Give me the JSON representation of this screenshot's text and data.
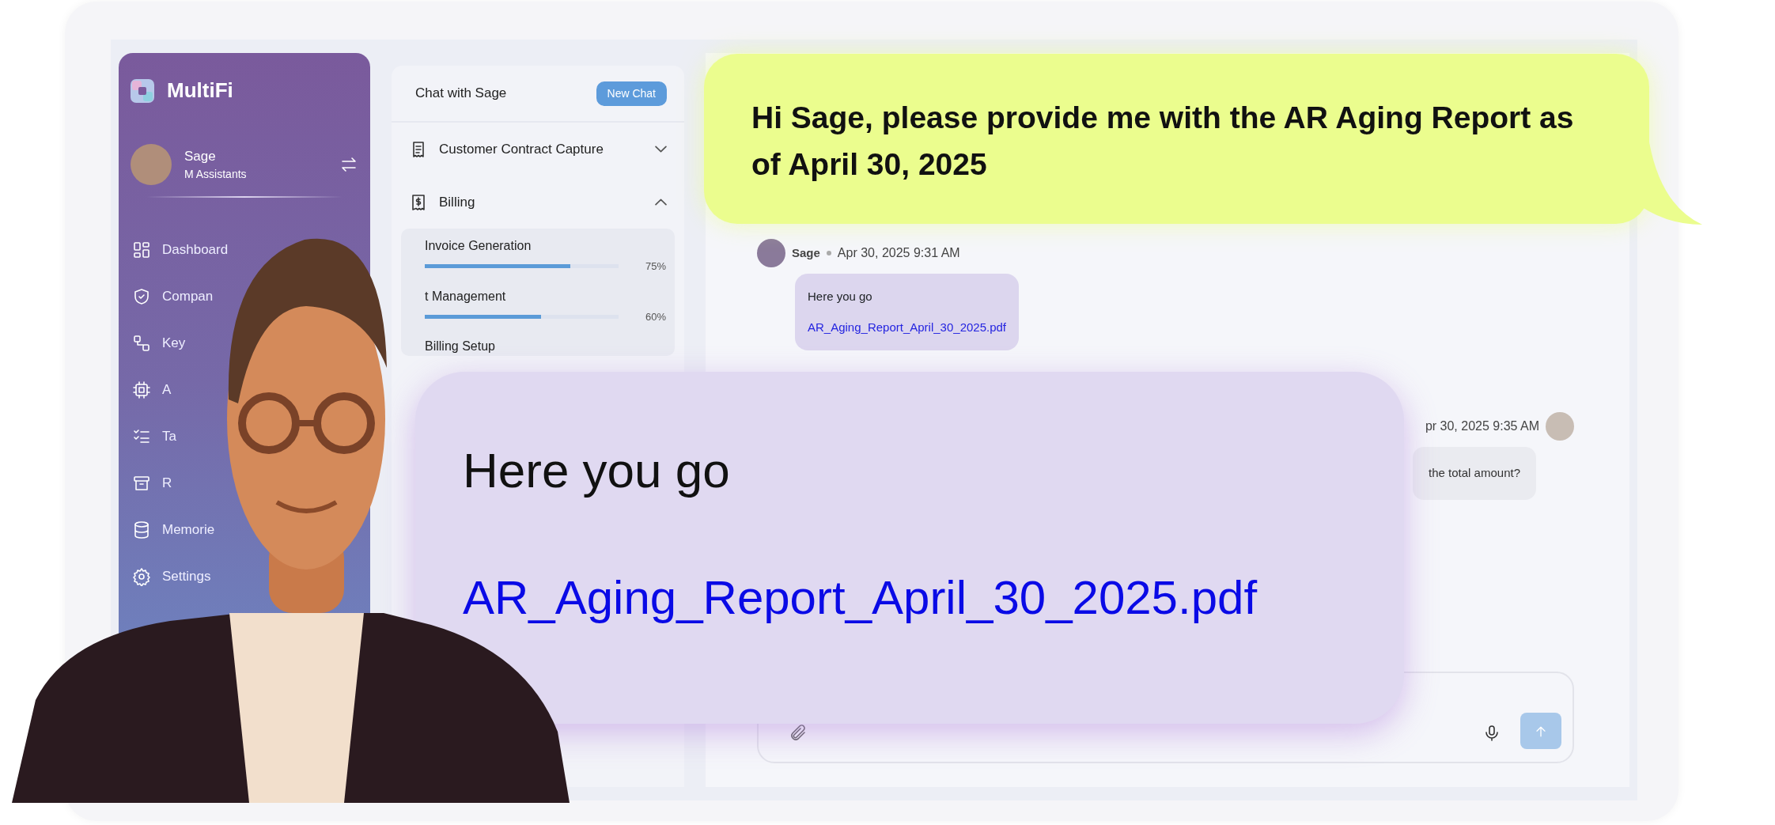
{
  "brand": {
    "name": "MultiFi"
  },
  "profile": {
    "name": "Sage",
    "role": "M Assistants"
  },
  "sidebar": {
    "items": [
      {
        "label": "Dashboard"
      },
      {
        "label": "Compan"
      },
      {
        "label": "Key"
      },
      {
        "label": "A"
      },
      {
        "label": "Ta"
      },
      {
        "label": "R"
      },
      {
        "label": "Memorie"
      },
      {
        "label": "Settings"
      }
    ]
  },
  "chat_panel": {
    "title": "Chat with Sage",
    "new_chat_button": "New Chat",
    "sections": [
      {
        "title": "Customer Contract Capture",
        "expanded": false
      },
      {
        "title": "Billing",
        "expanded": true,
        "tasks": [
          {
            "name": "Invoice Generation",
            "level": 0.75,
            "reading": "75%"
          },
          {
            "name": "t Management",
            "level": 0.6,
            "reading": "60%"
          },
          {
            "name": "Billing Setup"
          }
        ]
      }
    ]
  },
  "messages": [
    {
      "kind": "received",
      "sender": "Sage",
      "time": "Apr 30, 2025 9:31 AM",
      "text": "Here you go",
      "link": "AR_Aging_Report_April_30_2025.pdf"
    },
    {
      "kind": "sent",
      "time": "pr 30, 2025 9:35 AM",
      "text": "the total amount?"
    }
  ],
  "callouts": {
    "user_request": "Hi Sage, please provide me with the AR Aging Report as of April 30, 2025",
    "reply_zoom": {
      "text": "Here you go",
      "link": "AR_Aging_Report_April_30_2025.pdf"
    }
  }
}
